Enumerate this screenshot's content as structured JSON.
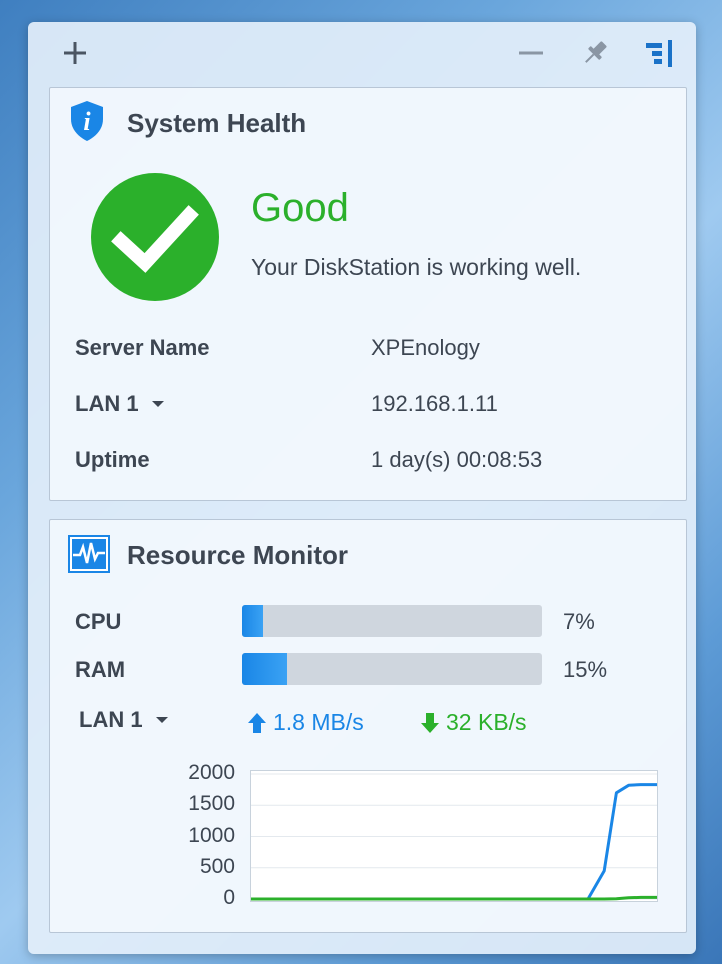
{
  "toolbar": {
    "add_icon": "plus-icon",
    "minimize_icon": "minus-icon",
    "pin_icon": "pin-icon",
    "panel_icon": "panel-toggle-icon"
  },
  "system_health": {
    "title": "System Health",
    "status": "Good",
    "status_message": "Your DiskStation is working well.",
    "status_color": "#2bb02b",
    "rows": [
      {
        "label": "Server Name",
        "value": "XPEnology"
      },
      {
        "label": "LAN 1",
        "value": "192.168.1.11"
      },
      {
        "label": "Uptime",
        "value": "1 day(s) 00:08:53"
      }
    ]
  },
  "resource_monitor": {
    "title": "Resource Monitor",
    "cpu": {
      "label": "CPU",
      "percent_text": "7%",
      "percent": 7
    },
    "ram": {
      "label": "RAM",
      "percent_text": "15%",
      "percent": 15
    },
    "lan": {
      "label": "LAN 1",
      "upload": "1.8 MB/s",
      "download": "32 KB/s"
    },
    "colors": {
      "upload": "#1a86e6",
      "download": "#2bb02b"
    }
  },
  "chart_data": {
    "type": "line",
    "ylim": [
      0,
      2000
    ],
    "yticks": [
      "2000",
      "1500",
      "1000",
      "500",
      "0"
    ],
    "x": [
      0,
      0.5,
      0.62,
      0.7,
      0.83,
      0.87,
      0.9,
      0.93,
      0.96,
      1.0
    ],
    "series": [
      {
        "values": [
          0,
          0,
          0,
          0,
          0,
          450,
          1700,
          1820,
          1830,
          1830
        ],
        "color": "#1a86e6"
      },
      {
        "values": [
          0,
          0,
          0,
          0,
          0,
          0,
          5,
          20,
          25,
          25
        ],
        "color": "#2bb02b"
      }
    ]
  }
}
